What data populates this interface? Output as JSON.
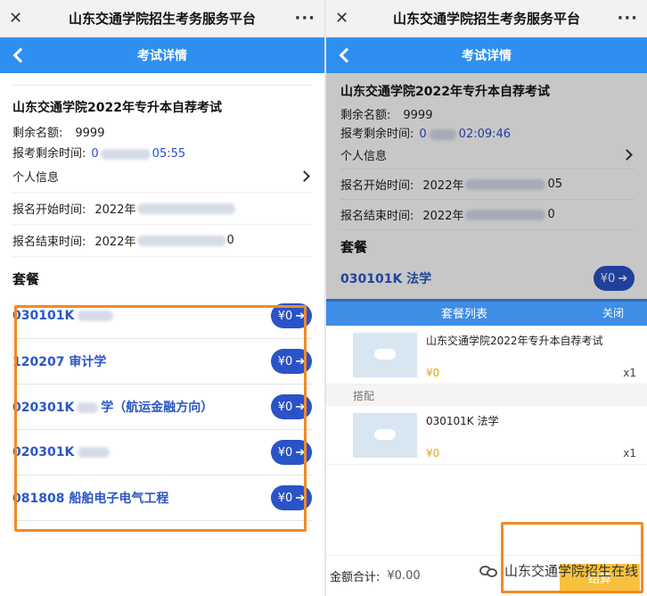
{
  "wechat": {
    "close_icon": "close-icon",
    "title": "山东交通学院招生考务服务平台",
    "more_label": "···"
  },
  "appbar": {
    "title": "考试详情"
  },
  "exam": {
    "title": "山东交通学院2022年专升本自荐考试",
    "remaining_label": "剩余名额:",
    "remaining_value": "9999",
    "countdown_label": "报考剩余时间:",
    "left_countdown_visible": "0",
    "left_countdown_tail": "05:55",
    "right_countdown_visible": "0",
    "right_countdown_tail": "02:09:46",
    "personal_info": "个人信息",
    "reg_start_label": "报名开始时间:",
    "left_reg_start_value": "2022年",
    "right_reg_start_value": "2022年",
    "right_reg_start_tail": "05",
    "reg_end_label": "报名结束时间:",
    "left_reg_end_value": "2022年",
    "left_reg_end_tail": "0",
    "right_reg_end_value": "2022年",
    "right_reg_end_tail": "0"
  },
  "packages": {
    "section_title": "套餐",
    "price_label": "¥0",
    "left_items": [
      {
        "code": "030101K",
        "name": ""
      },
      {
        "code": "120207",
        "name": "审计学"
      },
      {
        "code": "020301K",
        "name": "学（航运金融方向）"
      },
      {
        "code": "020301K",
        "name": ""
      },
      {
        "code": "081808",
        "name": "船舶电子电气工程"
      }
    ],
    "right_item": {
      "label": "030101K 法学"
    }
  },
  "sheet": {
    "title": "套餐列表",
    "close_label": "关闭",
    "main_item": {
      "name": "山东交通学院2022年专升本自荐考试",
      "price": "¥0",
      "qty": "x1"
    },
    "subhead": "搭配",
    "extra_item": {
      "name": "030101K 法学",
      "price": "¥0",
      "qty": "x1"
    }
  },
  "footer": {
    "total_label": "金额合计:",
    "total_value": "¥0.00",
    "settle_label": "结算"
  },
  "watermark": {
    "text": "山东交通学院招生在线"
  },
  "colors": {
    "appbar_blue": "#2f8ff0",
    "package_blue": "#2b56c6",
    "pill_blue": "#2a53c8",
    "highlight_orange": "#f28a26",
    "price_yellow": "#e8a317"
  }
}
